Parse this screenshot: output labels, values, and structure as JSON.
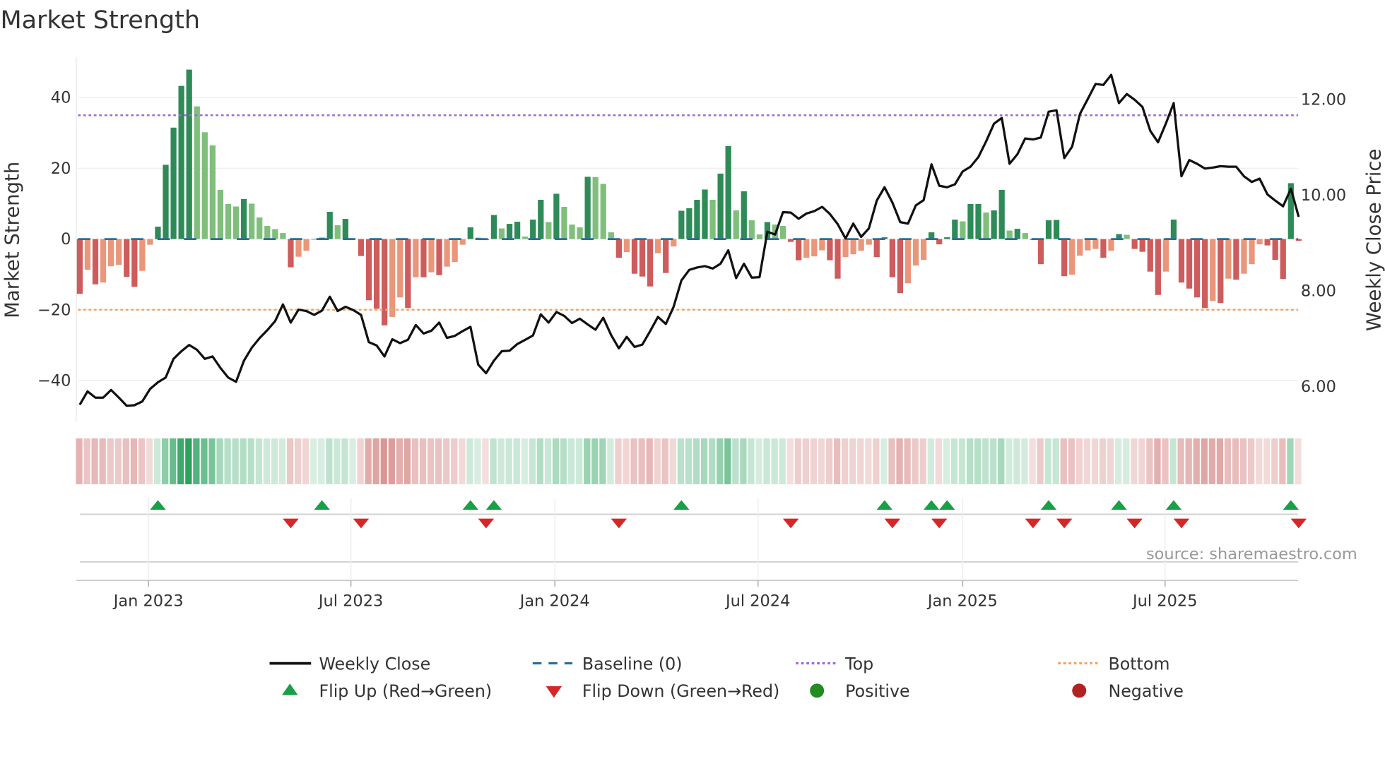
{
  "title": "Market Strength",
  "source": "source: sharemaestro.com",
  "colors": {
    "strong_up": "#2e8b57",
    "weak_up": "#7fbf7b",
    "strong_down": "#cd5c5c",
    "weak_down": "#e9967a",
    "close_line": "#111111",
    "baseline": "#2a6f97",
    "top": "#9b6bd6",
    "bottom": "#f4a460",
    "flip_up": "#1a9e48",
    "flip_down": "#d62728",
    "positive": "#228b22",
    "negative": "#b22222",
    "strip_green": "#2ca25f",
    "strip_red": "#c0504d"
  },
  "legend": {
    "weekly_close": "Weekly Close",
    "baseline": "Baseline (0)",
    "top": "Top",
    "bottom": "Bottom",
    "flip_up": "Flip Up (Red→Green)",
    "flip_down": "Flip Down (Green→Red)",
    "positive": "Positive",
    "negative": "Negative"
  },
  "chart_data": {
    "type": "bar",
    "title": "Market Strength",
    "ylabel": "Market Strength",
    "y2label": "Weekly Close Price",
    "ylim": [
      -50,
      55
    ],
    "y2lim": [
      5.3,
      13.0
    ],
    "yticks": [
      "40",
      "20",
      "0",
      "−20",
      "−40"
    ],
    "ytick_values": [
      40,
      20,
      0,
      -20,
      -40
    ],
    "y2ticks": [
      "12.00",
      "10.00",
      "8.00",
      "6.00"
    ],
    "y2tick_values": [
      12,
      10,
      8,
      6
    ],
    "top_level": 35,
    "bottom_level": -20,
    "baseline": 0,
    "x_unit": "week index",
    "xticks": [
      {
        "label": "Jan 2023",
        "week": 8.8
      },
      {
        "label": "Jul 2023",
        "week": 34.7
      },
      {
        "label": "Jan 2024",
        "week": 60.8
      },
      {
        "label": "Jul 2024",
        "week": 86.8
      },
      {
        "label": "Jan 2025",
        "week": 113.0
      },
      {
        "label": "Jul 2025",
        "week": 138.9
      }
    ],
    "strength": [
      -15.5,
      -8.7,
      -12.8,
      -12.3,
      -7.7,
      -7.3,
      -10.7,
      -13.5,
      -9,
      -1.6,
      3.5,
      21,
      31.5,
      43.3,
      47.9,
      37.5,
      30.2,
      26.5,
      13.9,
      9.9,
      9.2,
      11.3,
      10,
      6.1,
      3.7,
      2.8,
      1.7,
      -8,
      -5,
      -3.3,
      0,
      0.4,
      7.7,
      3.9,
      5.7,
      0.2,
      -4.8,
      -17.3,
      -19.7,
      -24.4,
      -22,
      -16.5,
      -19.5,
      -10.8,
      -10.8,
      -9.4,
      -10.2,
      -7.8,
      -6.5,
      -1.6,
      3.3,
      0.4,
      -0.3,
      6.8,
      3.0,
      4.3,
      4.9,
      0.7,
      5.5,
      11.1,
      4.8,
      12.8,
      9.1,
      4.1,
      3.3,
      17.6,
      17.5,
      15.6,
      1.9,
      -5.3,
      -3.7,
      -9.8,
      -10.6,
      -13.4,
      -4.0,
      -9.6,
      -2.1,
      8.0,
      8.7,
      11.1,
      14.0,
      11.1,
      18.5,
      26.3,
      8.1,
      13.5,
      5.3,
      1.3,
      4.8,
      4.1,
      3.7,
      -0.8,
      -6,
      -5.3,
      -4.9,
      -3.2,
      -6,
      -11.2,
      -5.1,
      -4.3,
      -3.3,
      -1.6,
      -5.1,
      0.5,
      -10.8,
      -15.3,
      -12.5,
      -7.5,
      -5.9,
      1.9,
      -1.5,
      0.5,
      5.5,
      5,
      9.9,
      9.9,
      7.5,
      8.1,
      13.9,
      2.4,
      2.9,
      1.7,
      -0.3,
      -7.1,
      5.3,
      5.4,
      -10.5,
      -10.1,
      -4.7,
      -3.2,
      -2.8,
      -5.3,
      -3.3,
      1.4,
      1.2,
      -2.8,
      -3.6,
      -9.2,
      -15.8,
      -9.2,
      5.5,
      -12.3,
      -14,
      -16.5,
      -19.5,
      -17.5,
      -18.1,
      -11.2,
      -11.5,
      -9.8,
      -7.1,
      -1.5,
      -1.8,
      -5.9,
      -11.3,
      15.8,
      -0.5
    ],
    "close": [
      5.6,
      5.88,
      5.75,
      5.75,
      5.91,
      5.75,
      5.58,
      5.59,
      5.67,
      5.93,
      6.07,
      6.17,
      6.56,
      6.72,
      6.85,
      6.75,
      6.56,
      6.61,
      6.37,
      6.17,
      6.08,
      6.52,
      6.79,
      6.99,
      7.16,
      7.35,
      7.7,
      7.32,
      7.59,
      7.56,
      7.48,
      7.57,
      7.86,
      7.56,
      7.65,
      7.58,
      7.48,
      6.91,
      6.84,
      6.61,
      6.97,
      6.89,
      6.96,
      7.27,
      7.09,
      7.15,
      7.32,
      7.0,
      7.04,
      7.14,
      7.23,
      6.44,
      6.26,
      6.52,
      6.72,
      6.73,
      6.87,
      6.96,
      7.05,
      7.49,
      7.32,
      7.54,
      7.46,
      7.31,
      7.4,
      7.28,
      7.17,
      7.42,
      7.06,
      6.78,
      7.02,
      6.81,
      6.86,
      7.14,
      7.44,
      7.29,
      7.65,
      8.2,
      8.42,
      8.47,
      8.5,
      8.45,
      8.55,
      8.83,
      8.25,
      8.55,
      8.26,
      8.27,
      9.22,
      9.16,
      9.63,
      9.62,
      9.49,
      9.6,
      9.65,
      9.74,
      9.59,
      9.38,
      9.08,
      9.39,
      9.11,
      9.29,
      9.87,
      10.15,
      9.83,
      9.42,
      9.39,
      9.77,
      9.88,
      10.63,
      10.18,
      10.15,
      10.21,
      10.48,
      10.58,
      10.78,
      11.11,
      11.48,
      11.6,
      10.64,
      10.84,
      11.17,
      11.15,
      11.19,
      11.73,
      11.76,
      10.76,
      11.0,
      11.68,
      11.99,
      12.31,
      12.29,
      12.5,
      11.91,
      12.1,
      11.98,
      11.83,
      11.33,
      11.09,
      11.48,
      11.91,
      10.38,
      10.72,
      10.64,
      10.54,
      10.56,
      10.59,
      10.58,
      10.58,
      10.38,
      10.26,
      10.33,
      10.0,
      9.87,
      9.75,
      10.12,
      9.53
    ],
    "flip_up_weeks": [
      10,
      31,
      50,
      53,
      77,
      103,
      109,
      111,
      124,
      133,
      140,
      155
    ],
    "flip_down_weeks": [
      27,
      36,
      52,
      69,
      91,
      104,
      110,
      122,
      126,
      135,
      141,
      156
    ]
  }
}
